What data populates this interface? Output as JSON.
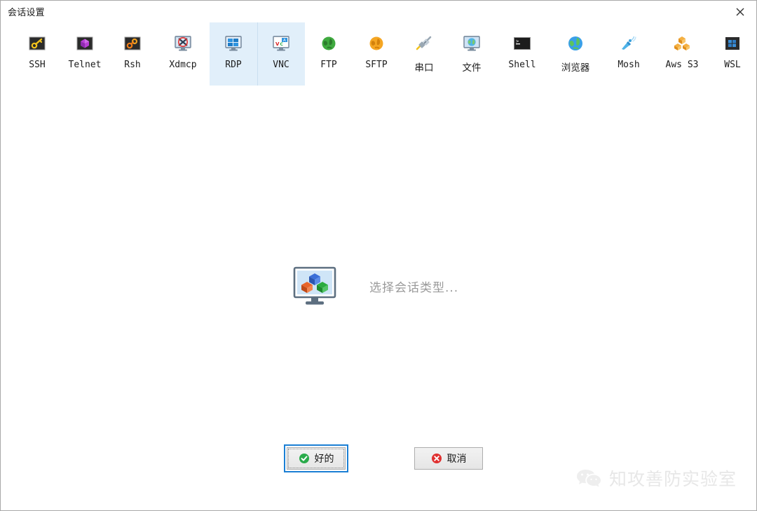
{
  "window": {
    "title": "会话设置",
    "close_label": "×",
    "close_icon": "close-icon"
  },
  "toolbar": {
    "items": [
      {
        "label": "SSH",
        "icon": "ssh-key-icon",
        "selected": false,
        "cjk": false
      },
      {
        "label": "Telnet",
        "icon": "telnet-gem-icon",
        "selected": false,
        "cjk": false
      },
      {
        "label": "Rsh",
        "icon": "rsh-key-icon",
        "selected": false,
        "cjk": false
      },
      {
        "label": "Xdmcp",
        "icon": "xdmcp-monitor-icon",
        "selected": false,
        "cjk": false
      },
      {
        "label": "RDP",
        "icon": "rdp-windows-icon",
        "selected": true,
        "cjk": false
      },
      {
        "label": "VNC",
        "icon": "vnc-monitor-icon",
        "selected": true,
        "cjk": false
      },
      {
        "label": "FTP",
        "icon": "ftp-globe-green-icon",
        "selected": false,
        "cjk": false
      },
      {
        "label": "SFTP",
        "icon": "sftp-globe-orange-icon",
        "selected": false,
        "cjk": false
      },
      {
        "label": "串口",
        "icon": "serial-plug-icon",
        "selected": false,
        "cjk": true
      },
      {
        "label": "文件",
        "icon": "file-monitor-icon",
        "selected": false,
        "cjk": true
      },
      {
        "label": "Shell",
        "icon": "shell-terminal-icon",
        "selected": false,
        "cjk": false
      },
      {
        "label": "浏览器",
        "icon": "browser-globe-icon",
        "selected": false,
        "cjk": true
      },
      {
        "label": "Mosh",
        "icon": "mosh-satellite-icon",
        "selected": false,
        "cjk": false
      },
      {
        "label": "Aws S3",
        "icon": "aws-s3-cubes-icon",
        "selected": false,
        "cjk": false
      },
      {
        "label": "WSL",
        "icon": "wsl-windows-icon",
        "selected": false,
        "cjk": false
      }
    ]
  },
  "main": {
    "placeholder_text": "选择会话类型...",
    "placeholder_icon": "monitor-cubes-icon"
  },
  "footer": {
    "ok_label": "好的",
    "ok_icon": "green-check-icon",
    "cancel_label": "取消",
    "cancel_icon": "red-x-icon"
  },
  "watermark": {
    "text": "知攻善防实验室",
    "logo_icon": "wechat-icon"
  },
  "colors": {
    "selection": "#e1effa",
    "focus_outline": "#1b7fd4",
    "ok_icon": "#2aab4b",
    "cancel_icon": "#e03030",
    "placeholder_text": "#9a9a9a",
    "watermark": "#e3e3e3"
  }
}
